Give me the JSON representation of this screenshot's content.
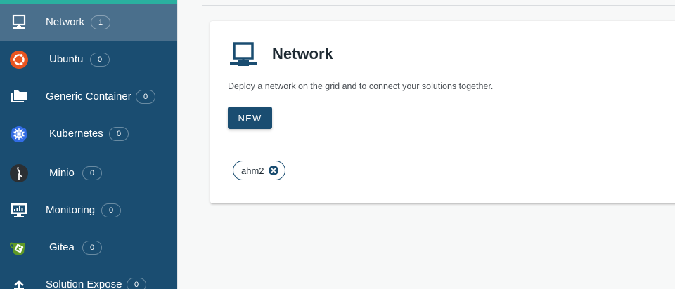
{
  "sidebar": {
    "items": [
      {
        "label": "Network",
        "count": "1",
        "icon": "monitor-network-icon",
        "active": true
      },
      {
        "label": "Ubuntu",
        "count": "0",
        "icon": "ubuntu-icon"
      },
      {
        "label": "Generic Container",
        "count": "0",
        "icon": "folders-icon"
      },
      {
        "label": "Kubernetes",
        "count": "0",
        "icon": "kubernetes-icon"
      },
      {
        "label": "Minio",
        "count": "0",
        "icon": "minio-icon"
      },
      {
        "label": "Monitoring",
        "count": "0",
        "icon": "monitoring-icon"
      },
      {
        "label": "Gitea",
        "count": "0",
        "icon": "gitea-icon"
      },
      {
        "label": "Solution Expose",
        "count": "0",
        "icon": "upload-icon"
      }
    ]
  },
  "main": {
    "title": "Network",
    "description": "Deploy a network on the grid and to connect your solutions together.",
    "new_button": "NEW",
    "chips": [
      {
        "label": "ahm2"
      }
    ]
  },
  "colors": {
    "sidebar_bg": "#1a4d71",
    "sidebar_active": "#4a6f8c",
    "accent": "#2ab0a0",
    "primary": "#1a4d71"
  }
}
